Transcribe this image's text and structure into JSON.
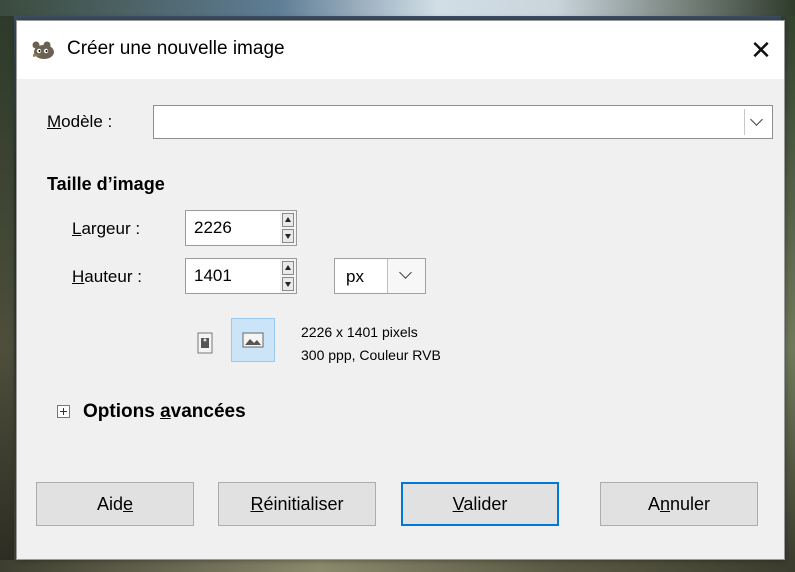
{
  "window": {
    "title": "Créer une nouvelle image",
    "close_glyph": "✕"
  },
  "template": {
    "label_mnemonic": "M",
    "label_rest": "odèle :",
    "value": ""
  },
  "image_size": {
    "section_title": "Taille d’image",
    "width": {
      "label_mnemonic": "L",
      "label_rest": "argeur :",
      "value": "2226"
    },
    "height": {
      "label_mnemonic": "H",
      "label_rest": "auteur :",
      "value": "1401"
    },
    "unit": "px",
    "info_line1": "2226 x 1401 pixels",
    "info_line2": "300 ppp, Couleur RVB",
    "orientation_selected": "landscape"
  },
  "advanced": {
    "label_before": "Options ",
    "label_mnemonic": "a",
    "label_after": "vancées"
  },
  "buttons": {
    "help": {
      "before": "Aid",
      "mnemonic": "e",
      "after": ""
    },
    "reset": {
      "before": "",
      "mnemonic": "R",
      "after": "éinitialiser"
    },
    "ok": {
      "before": "",
      "mnemonic": "V",
      "after": "alider"
    },
    "cancel": {
      "before": "A",
      "mnemonic": "n",
      "after": "nuler"
    }
  },
  "colors": {
    "accent": "#0078d7",
    "selected_bg": "#cce4f7"
  }
}
